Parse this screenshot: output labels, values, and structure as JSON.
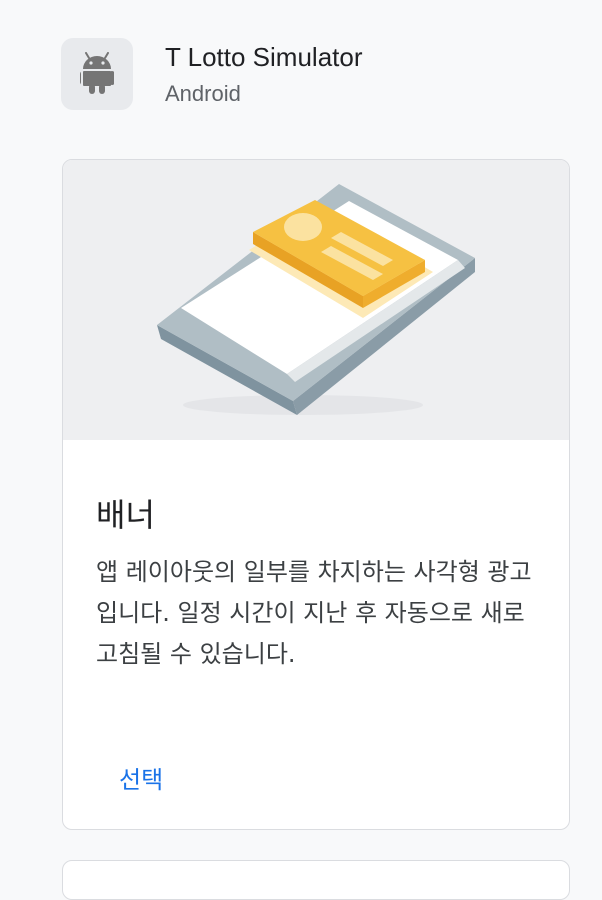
{
  "app": {
    "name": "T Lotto Simulator",
    "platform": "Android",
    "icon": "android-icon"
  },
  "format_card": {
    "illustration": "banner-ad-illustration",
    "title": "배너",
    "description": "앱 레이아웃의 일부를 차지하는 사각형 광고입니다. 일정 시간이 지난 후 자동으로 새로고침될 수 있습니다.",
    "select_label": "선택"
  },
  "colors": {
    "accent": "#1a73e8",
    "card_border": "#dadce0",
    "illustration_bg": "#eeeff1",
    "banner_yellow": "#f6c142"
  }
}
